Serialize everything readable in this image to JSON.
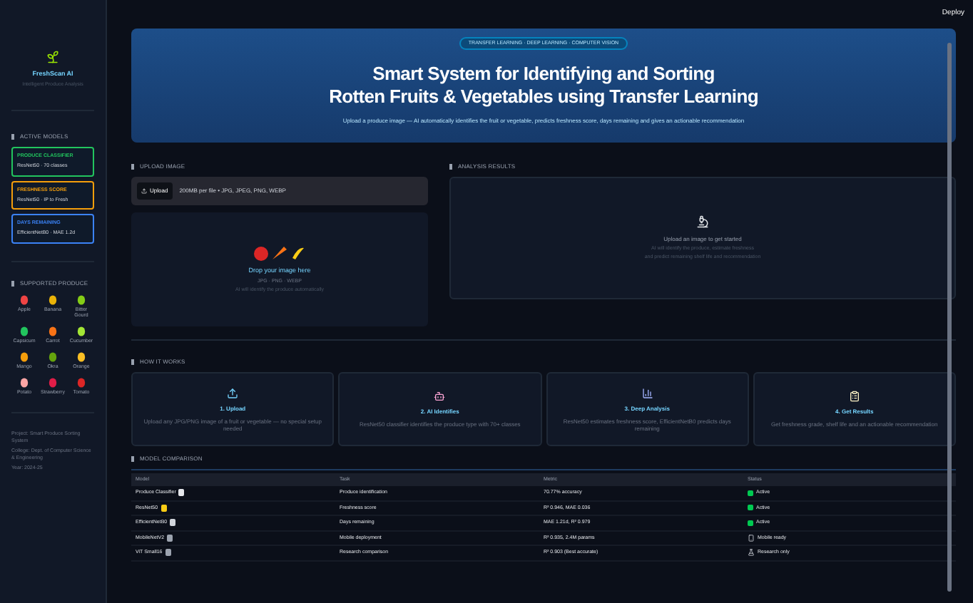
{
  "top_bar": {
    "deploy": "Deploy"
  },
  "sidebar": {
    "app_name": "FreshScan AI",
    "tagline": "Intelligent Produce Analysis",
    "models_heading": "ACTIVE MODELS",
    "models": [
      {
        "name": "PRODUCE CLASSIFIER",
        "detail": "ResNet50 · 70 classes",
        "color": "#22c55e"
      },
      {
        "name": "FRESHNESS SCORE",
        "detail": "ResNet50 · IP to Fresh",
        "color": "#f59e0b"
      },
      {
        "name": "DAYS REMAINING",
        "detail": "EfficientNetB0 · MAE 1.2d",
        "color": "#3b82f6"
      }
    ],
    "produce_heading": "SUPPORTED PRODUCE",
    "produce": [
      {
        "label": "Apple",
        "color": "#ef4444"
      },
      {
        "label": "Banana",
        "color": "#eab308"
      },
      {
        "label": "Bitter Gourd",
        "color": "#84cc16"
      },
      {
        "label": "Capsicum",
        "color": "#22c55e"
      },
      {
        "label": "Carrot",
        "color": "#f97316"
      },
      {
        "label": "Cucumber",
        "color": "#a3e635"
      },
      {
        "label": "Mango",
        "color": "#f59e0b"
      },
      {
        "label": "Okra",
        "color": "#65a30d"
      },
      {
        "label": "Orange",
        "color": "#fbbf24"
      },
      {
        "label": "Potato",
        "color": "#fca5a5"
      },
      {
        "label": "Strawberry",
        "color": "#e11d48"
      },
      {
        "label": "Tomato",
        "color": "#dc2626"
      }
    ],
    "footer": [
      "Project: Smart Produce Sorting System",
      "College: Dept. of Computer Science & Engineering",
      "Year: 2024-25"
    ]
  },
  "hero": {
    "badge": "TRANSFER LEARNING · DEEP LEARNING · COMPUTER VISION",
    "title_lines": [
      "Smart System for Identifying and Sorting",
      "Rotten Fruits & Vegetables using Transfer Learning"
    ],
    "subtitle": "Upload a produce image — AI automatically identifies the fruit or vegetable, predicts freshness score, days remaining and gives an actionable recommendation"
  },
  "upload": {
    "heading": "UPLOAD IMAGE",
    "button": "Upload",
    "limits": "200MB per file • JPG, JPEG, PNG, WEBP",
    "drop_title": "Drop your image here",
    "drop_formats": "JPG · PNG · WEBP",
    "drop_hint": "AI will identify the produce automatically"
  },
  "results": {
    "heading": "ANALYSIS RESULTS",
    "title": "Upload an image to get started",
    "lines": [
      "AI will identify the produce, estimate freshness",
      "and predict remaining shelf life and recommendation"
    ]
  },
  "how_it_works": {
    "heading": "HOW IT WORKS",
    "steps": [
      {
        "kind": "upload",
        "title": "1. Upload",
        "text": "Upload any JPG/PNG image of a fruit or vegetable — no special setup needed"
      },
      {
        "kind": "robot",
        "title": "2. AI Identifies",
        "text": "ResNet50 classifier identifies the produce type with 70+ classes"
      },
      {
        "kind": "chart",
        "title": "3. Deep Analysis",
        "text": "ResNet50 estimates freshness score, EfficientNetB0 predicts days remaining"
      },
      {
        "kind": "report",
        "title": "4. Get Results",
        "text": "Get freshness grade, shelf life and an actionable recommendation"
      }
    ]
  },
  "model_comparison": {
    "heading": "MODEL COMPARISON",
    "columns": [
      "Model",
      "Task",
      "Metric",
      "Status"
    ],
    "rows": [
      {
        "model": "Produce Classifier",
        "color": "#e5e7eb",
        "task": "Produce identification",
        "metric": "70.77% accuracy",
        "status": "Active",
        "kind": "active"
      },
      {
        "model": "ResNet50",
        "color": "#facc15",
        "task": "Freshness score",
        "metric": "R² 0.946, MAE 0.036",
        "status": "Active",
        "kind": "active"
      },
      {
        "model": "EfficientNetB0",
        "color": "#d1d5db",
        "task": "Days remaining",
        "metric": "MAE 1.21d, R² 0.979",
        "status": "Active",
        "kind": "active"
      },
      {
        "model": "MobileNetV2",
        "color": "#9ca3af",
        "task": "Mobile deployment",
        "metric": "R² 0.935, 2.4M params",
        "status": "Mobile ready",
        "kind": "mobile"
      },
      {
        "model": "ViT Small16",
        "color": "#9ca3af",
        "task": "Research comparison",
        "metric": "R² 0.903 (Best accurate)",
        "status": "Research only",
        "kind": "research"
      }
    ]
  }
}
